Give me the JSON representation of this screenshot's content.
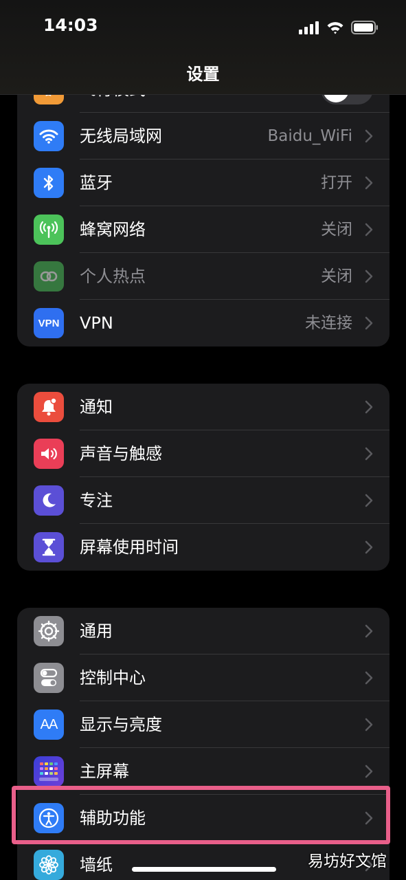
{
  "status_bar": {
    "time": "14:03"
  },
  "nav": {
    "title": "设置"
  },
  "group1": [
    {
      "label": "飞行模式",
      "value": "",
      "icon": "airplane-icon",
      "color": "#f19a37"
    },
    {
      "label": "无线局域网",
      "value": "Baidu_WiFi",
      "icon": "wifi-icon",
      "color": "#2f7cf6"
    },
    {
      "label": "蓝牙",
      "value": "打开",
      "icon": "bluetooth-icon",
      "color": "#2f7cf6"
    },
    {
      "label": "蜂窝网络",
      "value": "关闭",
      "icon": "antenna-icon",
      "color": "#4cc35a"
    },
    {
      "label": "个人热点",
      "value": "关闭",
      "icon": "hotspot-icon",
      "color": "#4cc35a"
    },
    {
      "label": "VPN",
      "value": "未连接",
      "icon": "vpn-icon",
      "icon_text": "VPN",
      "color": "#2f6ff0"
    }
  ],
  "group2": [
    {
      "label": "通知",
      "icon": "bell-icon",
      "color": "#eb4d3d"
    },
    {
      "label": "声音与触感",
      "icon": "speaker-icon",
      "color": "#ea3e57"
    },
    {
      "label": "专注",
      "icon": "moon-icon",
      "color": "#5b4fd6"
    },
    {
      "label": "屏幕使用时间",
      "icon": "hourglass-icon",
      "color": "#5b4fd6"
    }
  ],
  "group3": [
    {
      "label": "通用",
      "icon": "gear-icon",
      "color": "#8e8e93"
    },
    {
      "label": "控制中心",
      "icon": "switches-icon",
      "color": "#8e8e93"
    },
    {
      "label": "显示与亮度",
      "icon": "text-size-icon",
      "icon_text": "AA",
      "color": "#2f7cf6"
    },
    {
      "label": "主屏幕",
      "icon": "home-grid-icon",
      "color": "#3b3fd8"
    },
    {
      "label": "辅助功能",
      "icon": "accessibility-icon",
      "color": "#2f7cf6"
    },
    {
      "label": "墙纸",
      "icon": "flower-icon",
      "color": "#35aadc"
    }
  ],
  "watermark": "易坊好文馆"
}
